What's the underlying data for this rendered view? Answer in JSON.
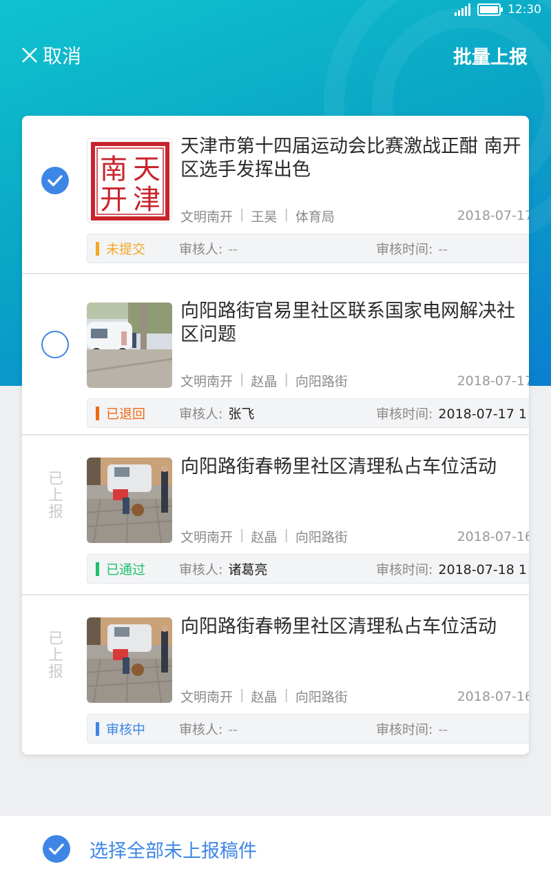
{
  "status_bar": {
    "time": "12:30",
    "icons": [
      "signal-icon",
      "battery-icon"
    ]
  },
  "header": {
    "cancel_label": "取消",
    "batch_report_label": "批量上报"
  },
  "colors": {
    "accent": "#3d86e6",
    "status_unsubmitted": "#f5a623",
    "status_returned": "#f06a14",
    "status_passed": "#1ec06b",
    "status_reviewing": "#3d86e6"
  },
  "items": [
    {
      "title": "天津市第十四届运动会比赛激战正酣 南开区选手发挥出色",
      "source": "文明南开",
      "author": "王昊",
      "department": "体育局",
      "date": "2018-07-17",
      "status": "未提交",
      "reviewer_label": "审核人:",
      "reviewer": "--",
      "review_time_label": "审核时间:",
      "review_time": "--",
      "selection": "checked",
      "thumb": "南开天津 seal"
    },
    {
      "title": "向阳路街官易里社区联系国家电网解决社区问题",
      "source": "文明南开",
      "author": "赵晶",
      "department": "向阳路街",
      "date": "2018-07-17",
      "status": "已退回",
      "reviewer_label": "审核人:",
      "reviewer": "张飞",
      "review_time_label": "审核时间:",
      "review_time": "2018-07-17 1",
      "selection": "unchecked"
    },
    {
      "title": "向阳路街春畅里社区清理私占车位活动",
      "source": "文明南开",
      "author": "赵晶",
      "department": "向阳路街",
      "date": "2018-07-16",
      "status": "已通过",
      "reviewer_label": "审核人:",
      "reviewer": "诸葛亮",
      "review_time_label": "审核时间:",
      "review_time": "2018-07-18 1",
      "selection": "reported",
      "reported_label": "已上报"
    },
    {
      "title": "向阳路街春畅里社区清理私占车位活动",
      "source": "文明南开",
      "author": "赵晶",
      "department": "向阳路街",
      "date": "2018-07-16",
      "status": "审核中",
      "reviewer_label": "审核人:",
      "reviewer": "--",
      "review_time_label": "审核时间:",
      "review_time": "--",
      "selection": "reported",
      "reported_label": "已上报"
    }
  ],
  "footer": {
    "select_all_label": "选择全部未上报稿件"
  }
}
